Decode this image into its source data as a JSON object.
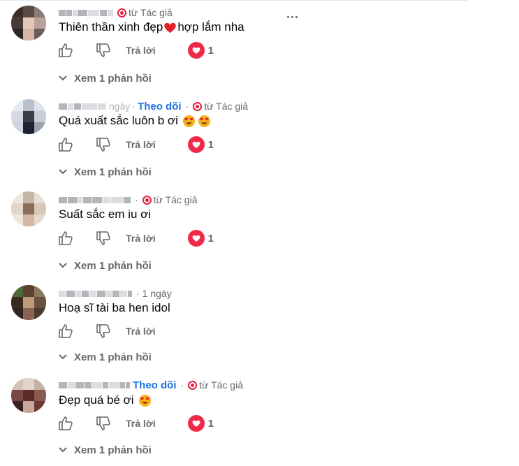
{
  "ui": {
    "badge_text": "từ Tác giả",
    "follow_text": "Theo dõi",
    "reply_label": "Trả lời",
    "view_replies_label": "Xem 1 phản hồi",
    "more_icon": "more-horizontal-icon",
    "like_icon": "thumbs-up-icon",
    "dislike_icon": "thumbs-down-icon",
    "heart_color": "#f0284a",
    "badge_color": "#e41e3f",
    "follow_color": "#1b74e4"
  },
  "comments": [
    {
      "text": "Thiên thần xinh đẹp",
      "emoji": "red-heart",
      "text_after": " hợp lắm nha",
      "time": "",
      "follow": false,
      "badge": true,
      "reactions": "1"
    },
    {
      "text": "Quá xuất sắc luôn b ơi",
      "emoji": "heart-eyes-x2",
      "text_after": "",
      "time": "ngày",
      "follow": true,
      "badge": true,
      "reactions": "1"
    },
    {
      "text": "Suất sắc em iu ơi",
      "emoji": "",
      "text_after": "",
      "time": "",
      "follow": false,
      "badge": true,
      "reactions": "1"
    },
    {
      "text": "Hoạ sĩ tài ba hen idol",
      "emoji": "",
      "text_after": "",
      "time": "1 ngày",
      "follow": false,
      "badge": false,
      "reactions": ""
    },
    {
      "text": "Đẹp quá bé ơi",
      "emoji": "heart-eyes",
      "text_after": "",
      "time": "",
      "follow": true,
      "badge": true,
      "reactions": "1"
    }
  ]
}
